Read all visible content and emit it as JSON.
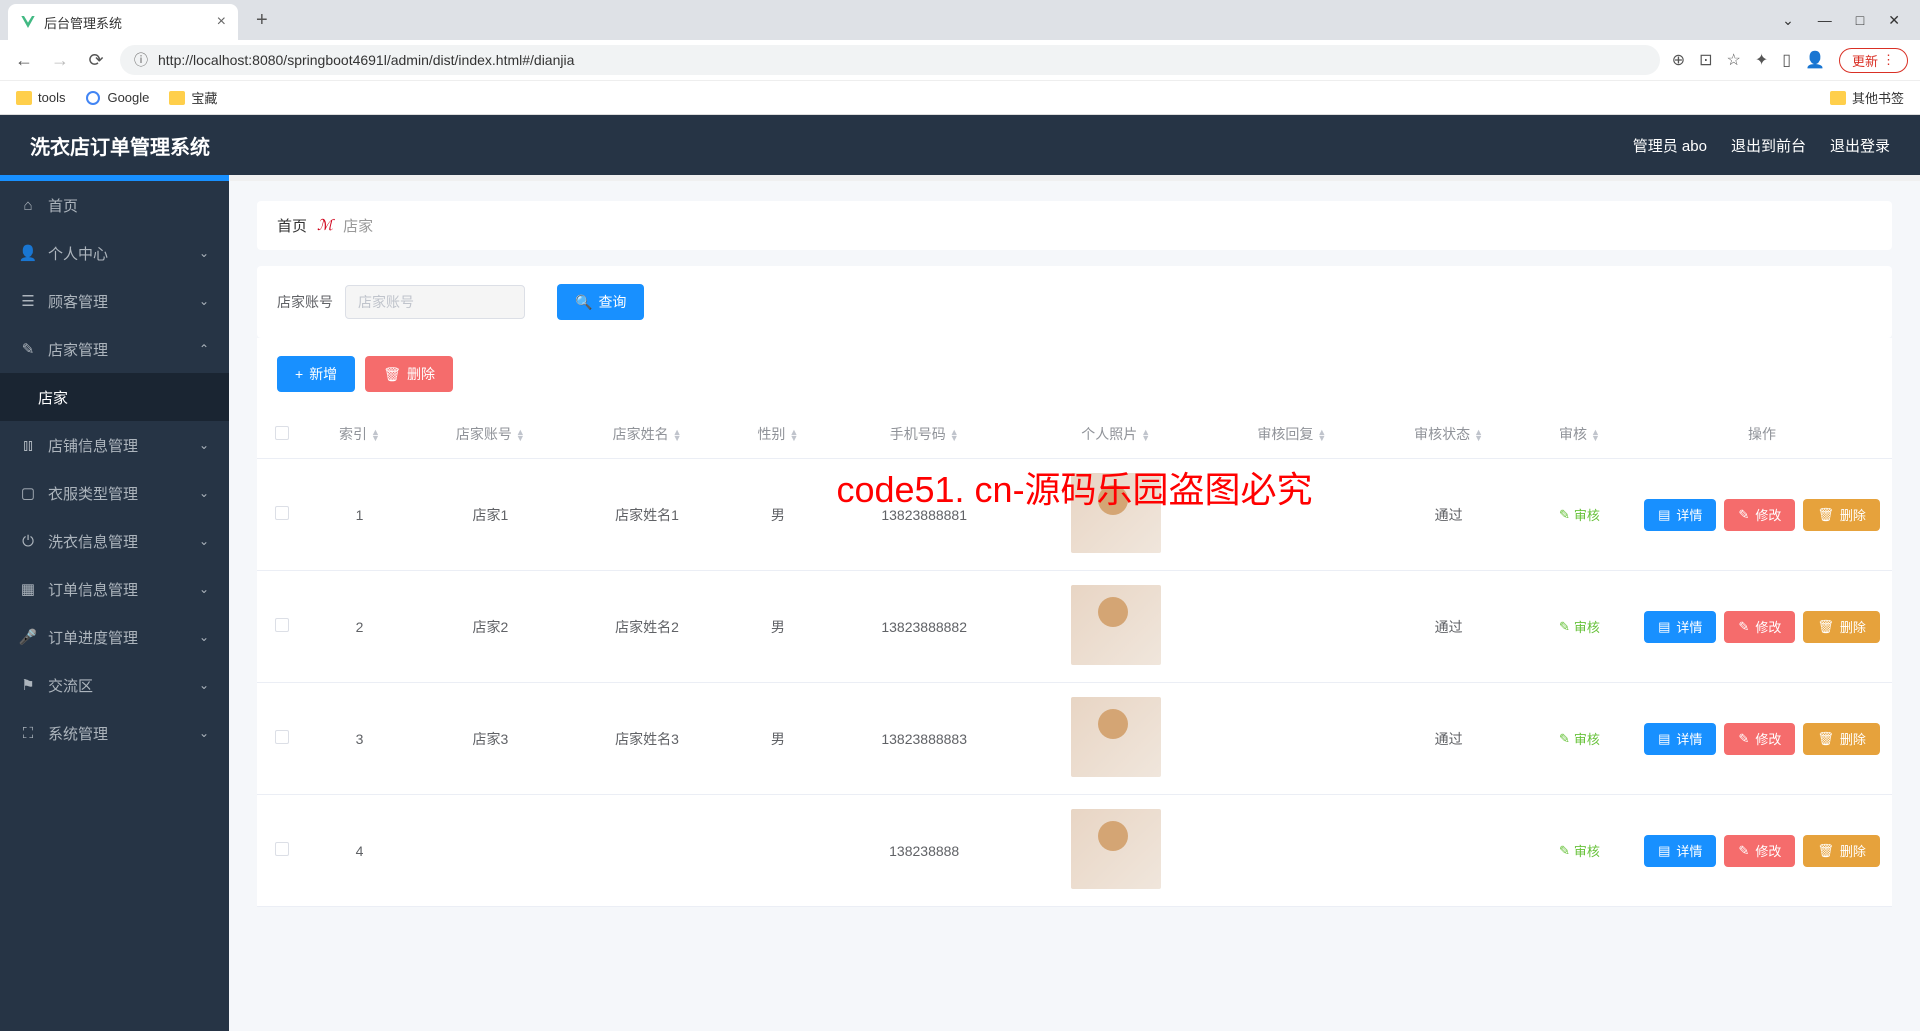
{
  "browser": {
    "tab_title": "后台管理系统",
    "url": "http://localhost:8080/springboot4691l/admin/dist/index.html#/dianjia",
    "update_label": "更新",
    "bookmarks": {
      "tools": "tools",
      "google": "Google",
      "treasure": "宝藏",
      "other": "其他书签"
    }
  },
  "header": {
    "app_title": "洗衣店订单管理系统",
    "user_label": "管理员 abo",
    "exit_front": "退出到前台",
    "logout": "退出登录"
  },
  "sidebar": {
    "home": "首页",
    "personal": "个人中心",
    "customer": "顾客管理",
    "shop_mgmt": "店家管理",
    "shop": "店家",
    "store_info": "店铺信息管理",
    "clothes_type": "衣服类型管理",
    "laundry_info": "洗衣信息管理",
    "order_info": "订单信息管理",
    "order_progress": "订单进度管理",
    "exchange": "交流区",
    "system": "系统管理"
  },
  "breadcrumb": {
    "home": "首页",
    "current": "店家"
  },
  "search": {
    "label": "店家账号",
    "placeholder": "店家账号",
    "query_btn": "查询"
  },
  "actions": {
    "add": "新增",
    "delete": "删除"
  },
  "table": {
    "headers": {
      "index": "索引",
      "account": "店家账号",
      "name": "店家姓名",
      "gender": "性别",
      "phone": "手机号码",
      "photo": "个人照片",
      "reply": "审核回复",
      "status": "审核状态",
      "audit": "审核",
      "op": "操作"
    },
    "audit_label": "审核",
    "btns": {
      "detail": "详情",
      "edit": "修改",
      "del": "删除"
    },
    "rows": [
      {
        "idx": "1",
        "account": "店家1",
        "name": "店家姓名1",
        "gender": "男",
        "phone": "13823888881",
        "status": "通过"
      },
      {
        "idx": "2",
        "account": "店家2",
        "name": "店家姓名2",
        "gender": "男",
        "phone": "13823888882",
        "status": "通过"
      },
      {
        "idx": "3",
        "account": "店家3",
        "name": "店家姓名3",
        "gender": "男",
        "phone": "13823888883",
        "status": "通过"
      },
      {
        "idx": "4",
        "account": "",
        "name": "",
        "gender": "",
        "phone": "138238888",
        "status": ""
      }
    ]
  },
  "watermark": "code51. cn-源码乐园盗图必究"
}
